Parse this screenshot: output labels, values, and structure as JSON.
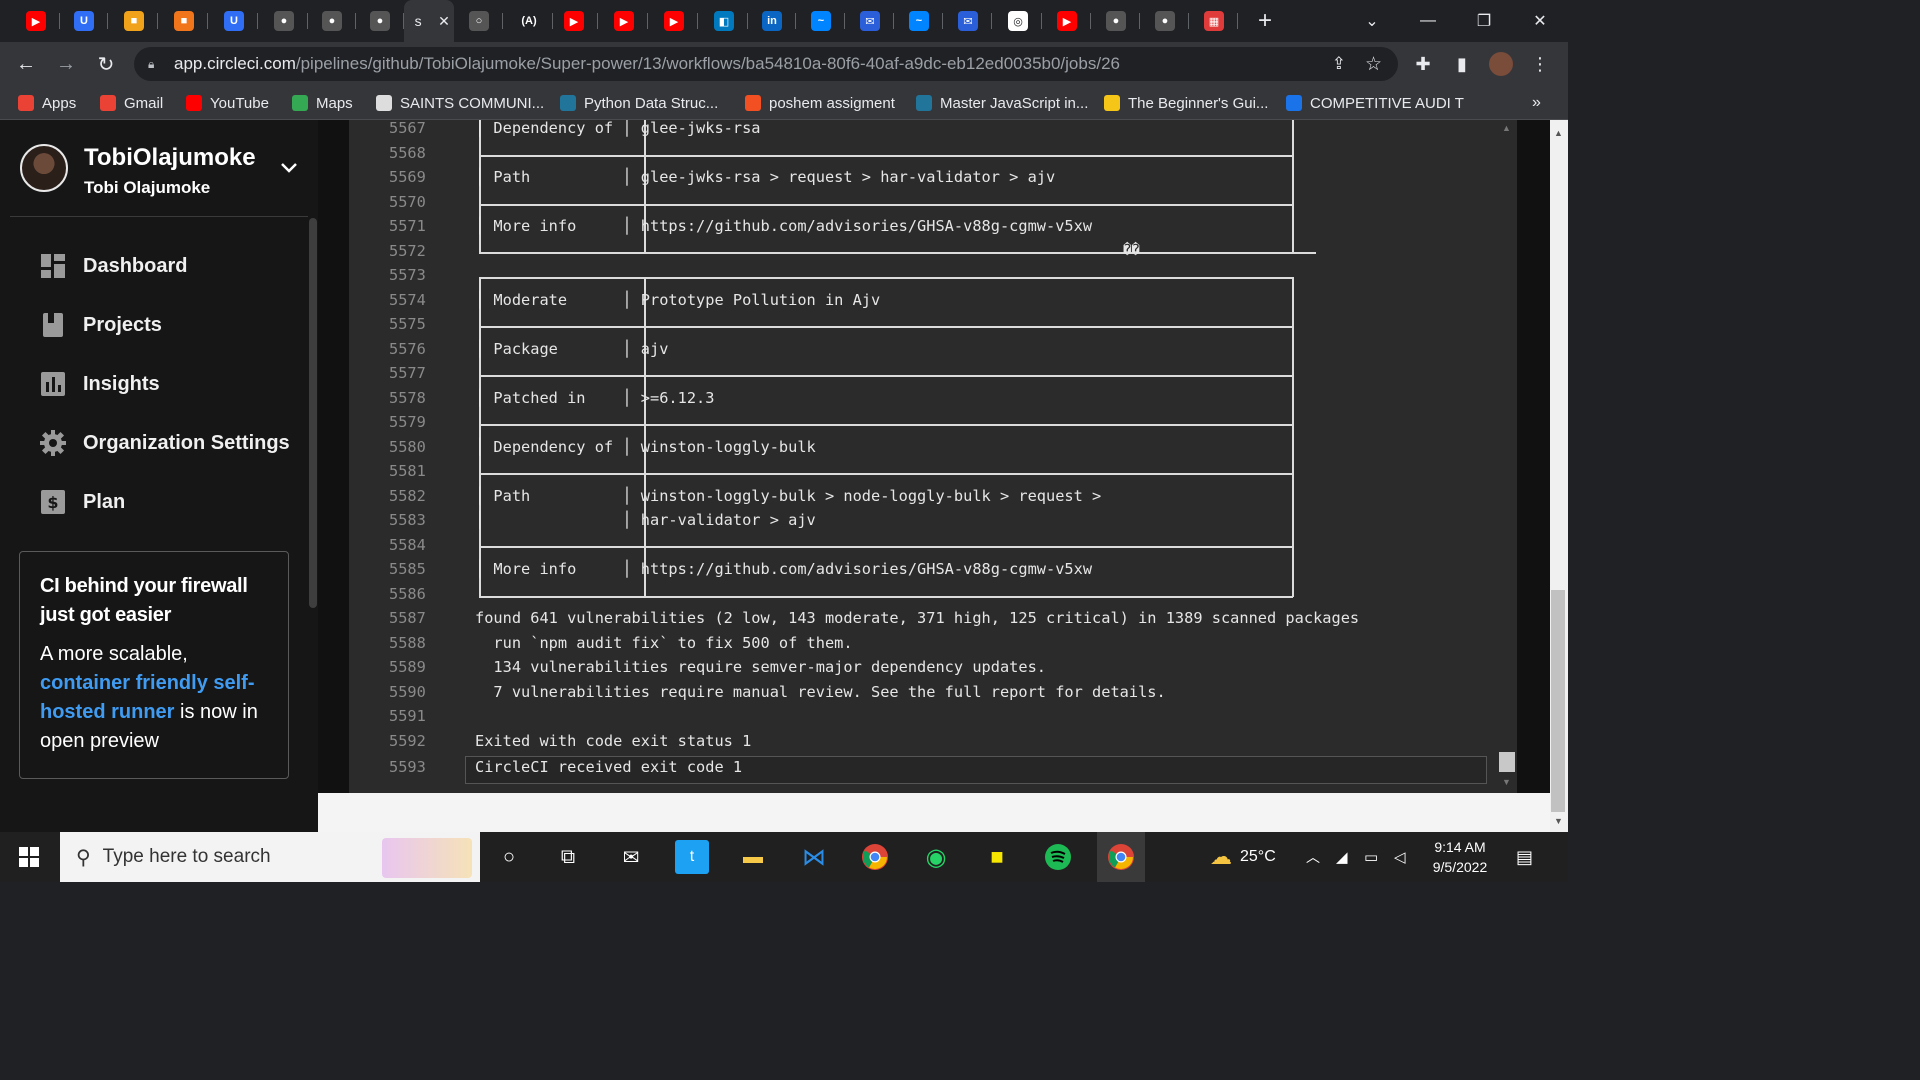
{
  "browser": {
    "tabs": [
      {
        "icon": "youtube-icon",
        "color": "#ff0000",
        "glyph": "▶"
      },
      {
        "icon": "ultra-icon",
        "color": "#2f6ef5",
        "glyph": "U"
      },
      {
        "icon": "package-icon",
        "color": "#f0a21b",
        "glyph": "■"
      },
      {
        "icon": "package-icon",
        "color": "#f0751b",
        "glyph": "■"
      },
      {
        "icon": "ultra-icon",
        "color": "#2f6ef5",
        "glyph": "U"
      },
      {
        "icon": "github-icon",
        "color": "#555555",
        "glyph": "●"
      },
      {
        "icon": "github-icon",
        "color": "#555555",
        "glyph": "●"
      },
      {
        "icon": "github-icon",
        "color": "#555555",
        "glyph": "●"
      },
      {
        "icon": "circleci-icon",
        "color": "#35363a",
        "glyph": "s",
        "active": true
      },
      {
        "icon": "loading-icon",
        "color": "#555555",
        "glyph": "○"
      },
      {
        "icon": "algolia-icon",
        "color": "#202124",
        "glyph": "(A)"
      },
      {
        "icon": "youtube-icon",
        "color": "#ff0000",
        "glyph": "▶"
      },
      {
        "icon": "youtube-icon",
        "color": "#ff0000",
        "glyph": "▶"
      },
      {
        "icon": "youtube-icon",
        "color": "#ff0000",
        "glyph": "▶"
      },
      {
        "icon": "trello-icon",
        "color": "#0079bf",
        "glyph": "◧"
      },
      {
        "icon": "linkedin-icon",
        "color": "#0a66c2",
        "glyph": "in"
      },
      {
        "icon": "messenger-icon",
        "color": "#0084ff",
        "glyph": "~"
      },
      {
        "icon": "mail-icon",
        "color": "#2b5fd9",
        "glyph": "✉"
      },
      {
        "icon": "messenger-icon",
        "color": "#0084ff",
        "glyph": "~"
      },
      {
        "icon": "mail-icon",
        "color": "#2b5fd9",
        "glyph": "✉"
      },
      {
        "icon": "chrome-icon",
        "color": "#ffffff",
        "glyph": "◎"
      },
      {
        "icon": "youtube-icon",
        "color": "#ff0000",
        "glyph": "▶"
      },
      {
        "icon": "github-icon",
        "color": "#555555",
        "glyph": "●"
      },
      {
        "icon": "github-icon",
        "color": "#555555",
        "glyph": "●"
      },
      {
        "icon": "grid-icon",
        "color": "#e03b3b",
        "glyph": "▦"
      }
    ],
    "active_tab_title": "s",
    "new_tab": "+",
    "url_host": "app.circleci.com",
    "url_path": "/pipelines/github/TobiOlajumoke/Super-power/13/workflows/ba54810a-80f6-40af-a9dc-eb12ed0035b0/jobs/26",
    "bookmarks": [
      {
        "label": "Apps",
        "icon": "apps-grid-icon",
        "color": "#ea4335"
      },
      {
        "label": "Gmail",
        "icon": "gmail-icon",
        "color": "#ea4335"
      },
      {
        "label": "YouTube",
        "icon": "youtube-icon",
        "color": "#ff0000"
      },
      {
        "label": "Maps",
        "icon": "maps-icon",
        "color": "#34a853"
      },
      {
        "label": "SAINTS COMMUNI...",
        "icon": "church-icon",
        "color": "#dddddd"
      },
      {
        "label": "Python  Data Struc...",
        "icon": "wordpress-icon",
        "color": "#21759b"
      },
      {
        "label": "poshem assigment",
        "icon": "microsoft-icon",
        "color": "#f25022"
      },
      {
        "label": "Master JavaScript in...",
        "icon": "wordpress-icon",
        "color": "#21759b"
      },
      {
        "label": "The Beginner's Gui...",
        "icon": "handshake-icon",
        "color": "#f5c518"
      },
      {
        "label": "COMPETITIVE AUDI T",
        "icon": "c-icon",
        "color": "#1a73e8"
      }
    ],
    "more_bookmarks": "»"
  },
  "sidebar": {
    "username": "TobiOlajumoke",
    "fullname": "Tobi Olajumoke",
    "items": [
      {
        "label": "Dashboard",
        "icon": "dashboard-icon"
      },
      {
        "label": "Projects",
        "icon": "projects-icon"
      },
      {
        "label": "Insights",
        "icon": "insights-icon"
      },
      {
        "label": "Organization Settings",
        "icon": "gear-icon"
      },
      {
        "label": "Plan",
        "icon": "dollar-icon"
      }
    ],
    "promo": {
      "heading": "CI behind your firewall just got easier",
      "body_before": "A more scalable,",
      "link": "container friendly self-hosted runner",
      "body_after": "is now in open preview"
    }
  },
  "terminal": {
    "lines": [
      {
        "n": "5567",
        "t": "│ Dependency of │ glee-jwks-rsa"
      },
      {
        "n": "5568",
        "t": ""
      },
      {
        "n": "5569",
        "t": "│ Path          │ glee-jwks-rsa > request > har-validator > ajv"
      },
      {
        "n": "5570",
        "t": ""
      },
      {
        "n": "5571",
        "t": "│ More info     │ https://github.com/advisories/GHSA-v88g-cgmw-v5xw"
      },
      {
        "n": "5572",
        "t": ""
      },
      {
        "n": "5573",
        "t": ""
      },
      {
        "n": "5574",
        "t": "│ Moderate      │ Prototype Pollution in Ajv"
      },
      {
        "n": "5575",
        "t": ""
      },
      {
        "n": "5576",
        "t": "│ Package       │ ajv"
      },
      {
        "n": "5577",
        "t": ""
      },
      {
        "n": "5578",
        "t": "│ Patched in    │ >=6.12.3"
      },
      {
        "n": "5579",
        "t": ""
      },
      {
        "n": "5580",
        "t": "│ Dependency of │ winston-loggly-bulk"
      },
      {
        "n": "5581",
        "t": ""
      },
      {
        "n": "5582",
        "t": "│ Path          │ winston-loggly-bulk > node-loggly-bulk > request >"
      },
      {
        "n": "5583",
        "t": "│               │ har-validator > ajv"
      },
      {
        "n": "5584",
        "t": ""
      },
      {
        "n": "5585",
        "t": "│ More info     │ https://github.com/advisories/GHSA-v88g-cgmw-v5xw"
      },
      {
        "n": "5586",
        "t": ""
      },
      {
        "n": "5587",
        "t": "found 641 vulnerabilities (2 low, 143 moderate, 371 high, 125 critical) in 1389 scanned packages"
      },
      {
        "n": "5588",
        "t": "  run `npm audit fix` to fix 500 of them."
      },
      {
        "n": "5589",
        "t": "  134 vulnerabilities require semver-major dependency updates."
      },
      {
        "n": "5590",
        "t": "  7 vulnerabilities require manual review. See the full report for details."
      },
      {
        "n": "5591",
        "t": ""
      },
      {
        "n": "5592",
        "t": "Exited with code exit status 1"
      },
      {
        "n": "5593",
        "t": "CircleCI received exit code 1"
      }
    ],
    "garbled": "��"
  },
  "taskbar": {
    "search_placeholder": "Type here to search",
    "temperature": "25°C",
    "time": "9:14 AM",
    "date": "9/5/2022"
  }
}
